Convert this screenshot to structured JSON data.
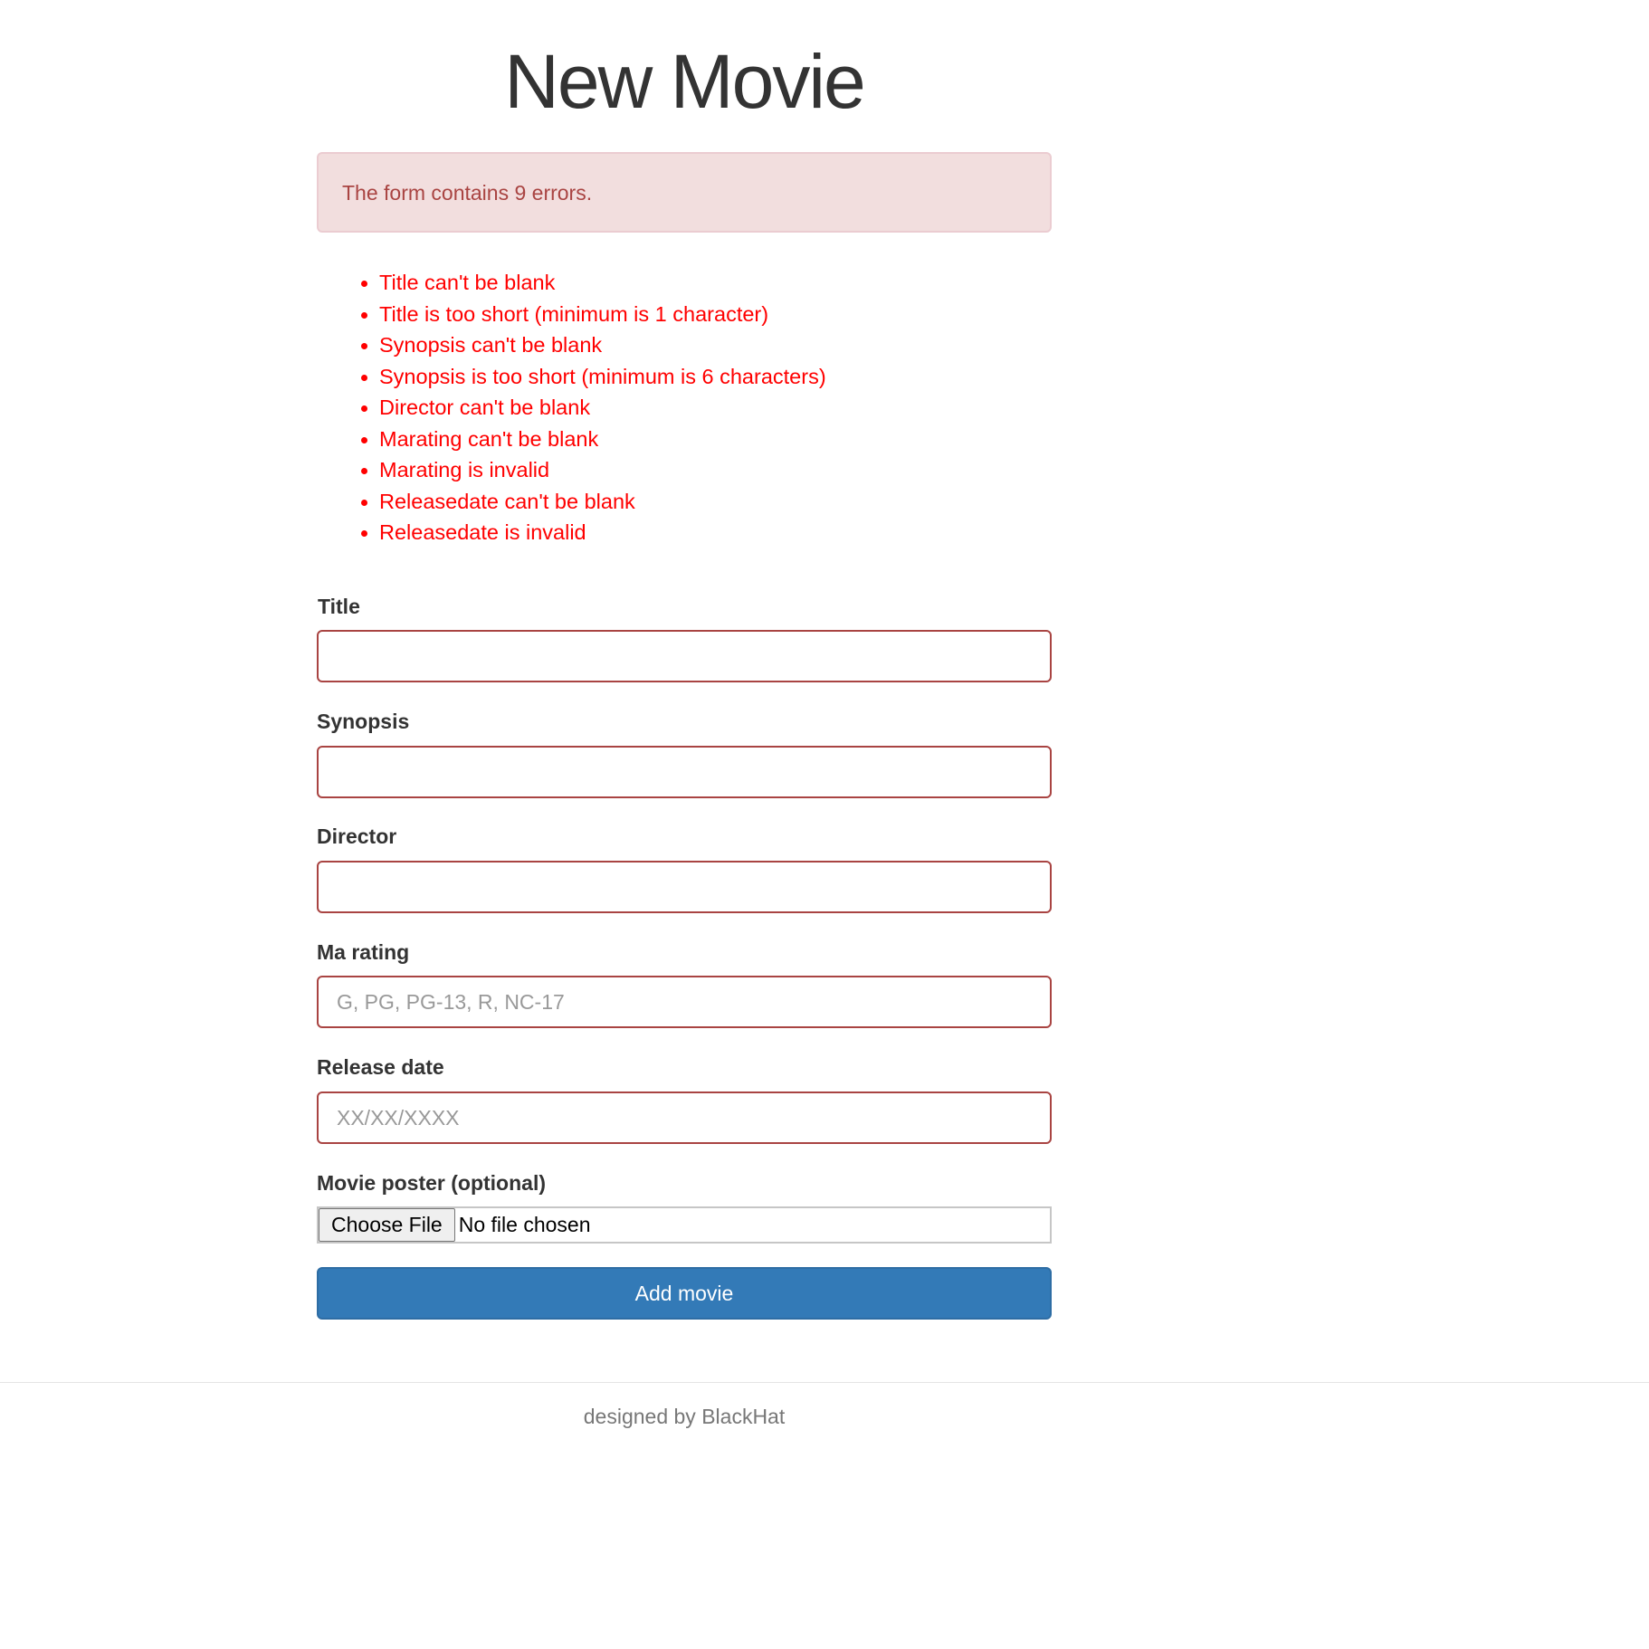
{
  "page": {
    "title": "New Movie"
  },
  "errors": {
    "summary": "The form contains 9 errors.",
    "items": [
      "Title can't be blank",
      "Title is too short (minimum is 1 character)",
      "Synopsis can't be blank",
      "Synopsis is too short (minimum is 6 characters)",
      "Director can't be blank",
      "Marating can't be blank",
      "Marating is invalid",
      "Releasedate can't be blank",
      "Releasedate is invalid"
    ]
  },
  "form": {
    "title": {
      "label": "Title",
      "value": "",
      "placeholder": ""
    },
    "synopsis": {
      "label": "Synopsis",
      "value": "",
      "placeholder": ""
    },
    "director": {
      "label": "Director",
      "value": "",
      "placeholder": ""
    },
    "ma_rating": {
      "label": "Ma rating",
      "value": "",
      "placeholder": "G, PG, PG-13, R, NC-17"
    },
    "release_date": {
      "label": "Release date",
      "value": "",
      "placeholder": "XX/XX/XXXX"
    },
    "poster": {
      "label": "Movie poster (optional)",
      "button_label": "Choose File",
      "status": "No file chosen"
    },
    "submit_label": "Add movie"
  },
  "footer": {
    "text": "designed by BlackHat"
  },
  "colors": {
    "error_text": "#ff0000",
    "alert_background": "#f2dede",
    "alert_text": "#a94442",
    "input_error_border": "#a94442",
    "primary_button": "#337ab7"
  }
}
